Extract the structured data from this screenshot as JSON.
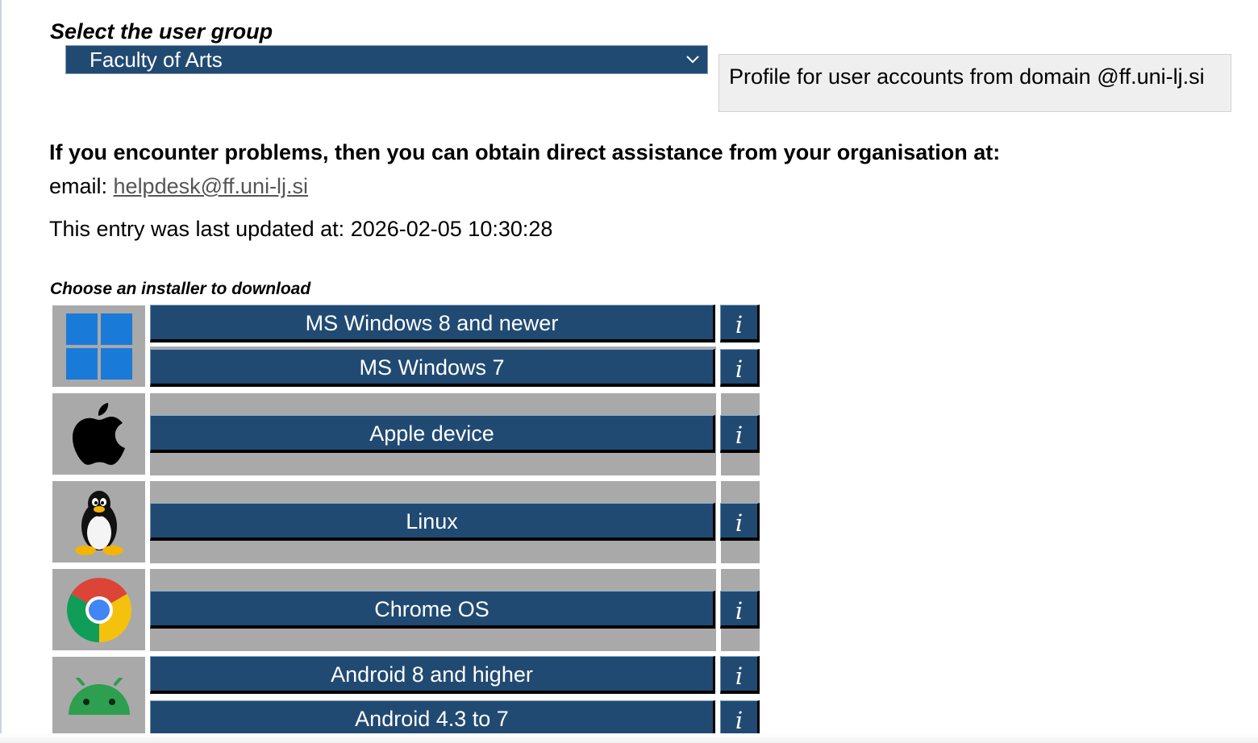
{
  "user_group": {
    "label": "Select the user group",
    "selected": "Faculty of Arts"
  },
  "profile_info": "Profile for user accounts from domain @ff.uni-lj.si",
  "support": {
    "heading": "If you encounter problems, then you can obtain direct assistance from your organisation at:",
    "email_label": "email: ",
    "email": "helpdesk@ff.uni-lj.si"
  },
  "last_updated": "This entry was last updated at: 2026-02-05 10:30:28",
  "installers": {
    "label": "Choose an installer to download",
    "info_label": "i",
    "windows_8": "MS Windows 8 and newer",
    "windows_7": "MS Windows 7",
    "apple": "Apple device",
    "linux": "Linux",
    "chromeos": "Chrome OS",
    "android_8": "Android 8 and higher",
    "android_43": "Android 4.3 to 7"
  },
  "icons": {
    "windows": "windows-logo-icon",
    "apple": "apple-logo-icon",
    "linux": "linux-tux-icon",
    "chrome": "chrome-logo-icon",
    "android": "android-logo-icon",
    "dropdown": "chevron-down-icon"
  },
  "colors": {
    "button": "#214a73",
    "cell": "#a9a9a9",
    "profile_box": "#efefef",
    "windows_blue": "#1a7ad8"
  }
}
